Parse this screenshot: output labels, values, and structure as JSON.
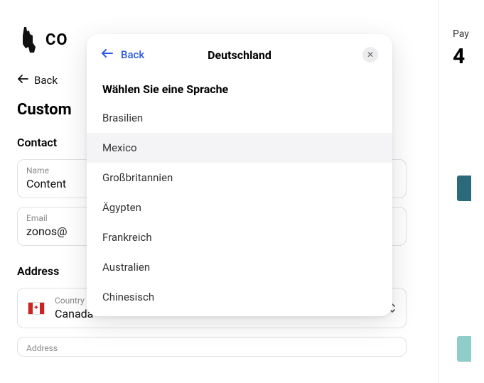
{
  "logo": {
    "text": "CO"
  },
  "page": {
    "back_label": "Back",
    "heading": "Custom"
  },
  "contact": {
    "section_label": "Contact",
    "name_label": "Name",
    "name_value": "Content",
    "email_label": "Email",
    "email_value": "zonos@"
  },
  "address": {
    "section_label": "Address",
    "country_label": "Country",
    "country_value": "Canada",
    "address_label": "Address"
  },
  "right": {
    "pay_label": "Pay",
    "pay_amount": "4"
  },
  "modal": {
    "back_label": "Back",
    "title": "Deutschland",
    "close_symbol": "✕",
    "subhead": "Wählen Sie eine Sprache",
    "languages": {
      "0": "Brasilien",
      "1": "Mexico",
      "2": "Großbritannien",
      "3": "Ägypten",
      "4": "Frankreich",
      "5": "Australien",
      "6": "Chinesisch"
    }
  }
}
